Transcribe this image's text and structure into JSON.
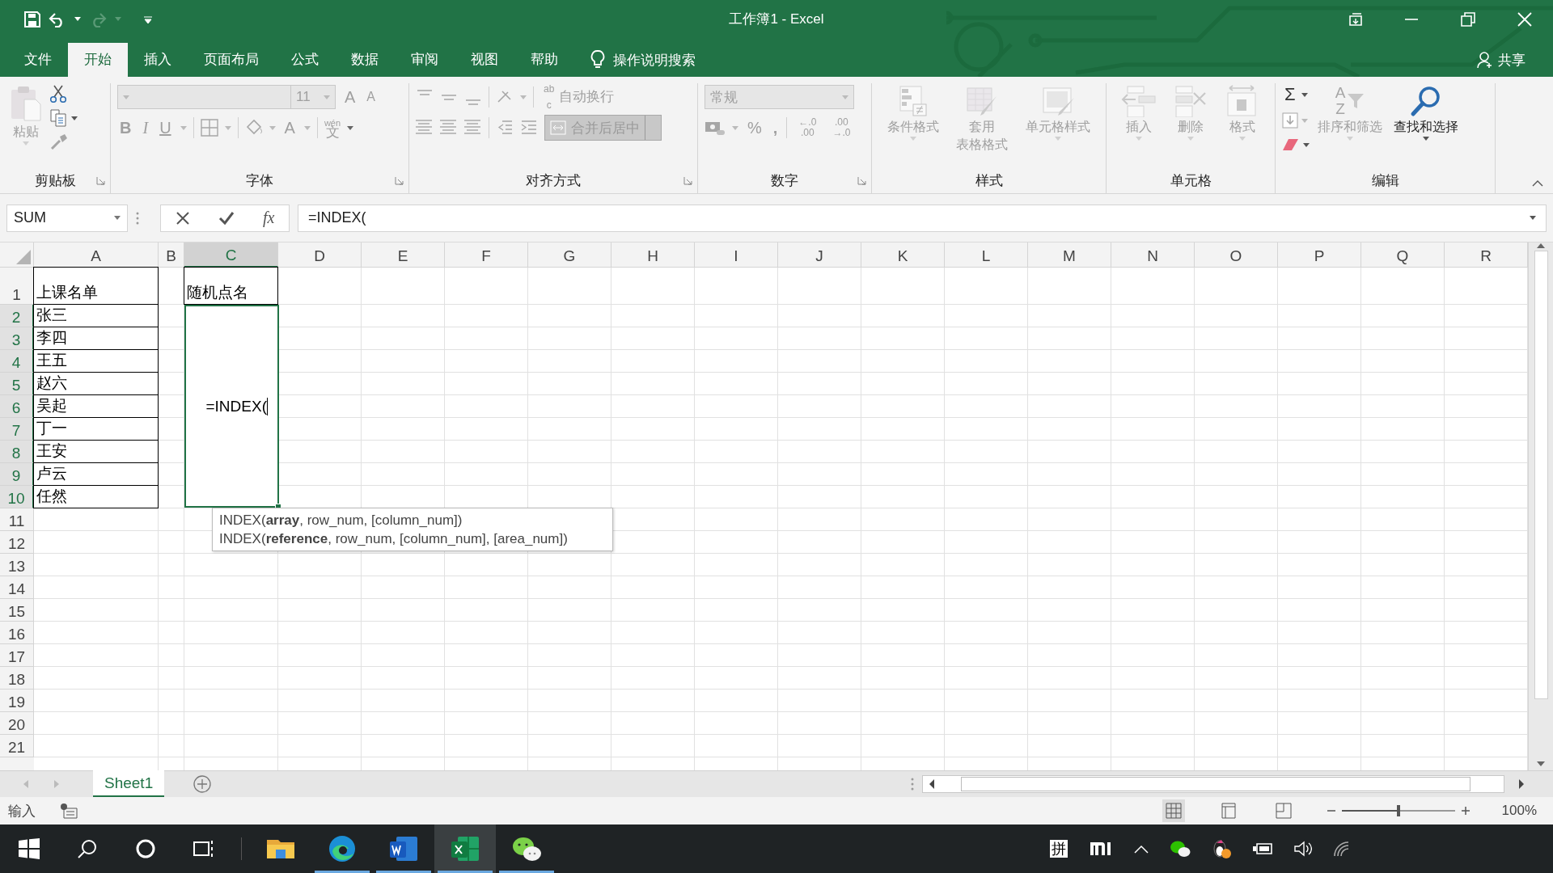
{
  "title_bar": {
    "title": "工作簿1 - Excel",
    "redo_disabled": true
  },
  "tabs": [
    {
      "label": "文件",
      "selected": false
    },
    {
      "label": "开始",
      "selected": true
    },
    {
      "label": "插入",
      "selected": false
    },
    {
      "label": "页面布局",
      "selected": false
    },
    {
      "label": "公式",
      "selected": false
    },
    {
      "label": "数据",
      "selected": false
    },
    {
      "label": "审阅",
      "selected": false
    },
    {
      "label": "视图",
      "selected": false
    },
    {
      "label": "帮助",
      "selected": false
    }
  ],
  "tell_me": {
    "label": "操作说明搜索"
  },
  "share": {
    "label": "共享"
  },
  "ribbon": [
    {
      "kind": "clipboard",
      "label": "剪贴板",
      "paste": {
        "label": "粘贴",
        "disabled": true
      }
    },
    {
      "kind": "font",
      "label": "字体",
      "font_size": "11",
      "grow": "A",
      "shrink": "A",
      "styles": [
        "B",
        "I",
        "U"
      ],
      "font_color": "A",
      "phonetic": [
        "wén",
        "文"
      ]
    },
    {
      "kind": "alignment",
      "label": "对齐方式",
      "wrap": {
        "icon_text": [
          "ab",
          "c"
        ],
        "label": "自动换行",
        "disabled": true
      },
      "merge": {
        "label": "合并后居中",
        "disabled": true
      }
    },
    {
      "kind": "number",
      "label": "数字",
      "format": "常规",
      "percent": "%",
      "comma": ",",
      "decimals": [
        {
          "top": "←.0",
          "bottom": ".00"
        },
        {
          "top": ".00",
          "bottom": "→.0"
        }
      ]
    },
    {
      "kind": "styles",
      "label": "样式",
      "commands": [
        {
          "label": "条件格式",
          "disabled": true
        },
        {
          "label": "套用",
          "label_2": "表格格式",
          "disabled": true
        },
        {
          "label": "单元格样式",
          "disabled": true
        }
      ]
    },
    {
      "kind": "cells",
      "label": "单元格",
      "commands": [
        {
          "label": "插入",
          "disabled": true
        },
        {
          "label": "删除",
          "disabled": true
        },
        {
          "label": "格式",
          "disabled": true
        }
      ]
    },
    {
      "kind": "editing",
      "label": "编辑",
      "sum": "Σ",
      "sort": {
        "label": "排序和筛选",
        "letters": [
          "A",
          "Z"
        ],
        "disabled": true
      },
      "find": {
        "label": "查找和选择",
        "disabled": false
      }
    }
  ],
  "formula_bar": {
    "name_box": "SUM",
    "fx": "fx",
    "formula": "=INDEX("
  },
  "columns": [
    {
      "label": "A",
      "selected": false
    },
    {
      "label": "B",
      "selected": false
    },
    {
      "label": "C",
      "selected": true
    },
    {
      "label": "D",
      "selected": false
    },
    {
      "label": "E",
      "selected": false
    },
    {
      "label": "F",
      "selected": false
    },
    {
      "label": "G",
      "selected": false
    },
    {
      "label": "H",
      "selected": false
    },
    {
      "label": "I",
      "selected": false
    },
    {
      "label": "J",
      "selected": false
    },
    {
      "label": "K",
      "selected": false
    },
    {
      "label": "L",
      "selected": false
    },
    {
      "label": "M",
      "selected": false
    },
    {
      "label": "N",
      "selected": false
    },
    {
      "label": "O",
      "selected": false
    },
    {
      "label": "P",
      "selected": false
    },
    {
      "label": "Q",
      "selected": false
    },
    {
      "label": "R",
      "selected": false
    }
  ],
  "rows": [
    {
      "header": "1",
      "selected": false,
      "a": {
        "text": "上课名单",
        "bordered": true
      },
      "c": {
        "text": "随机点名",
        "bordered": true
      }
    },
    {
      "header": "2",
      "selected": true,
      "a": {
        "text": "张三",
        "bordered": true
      }
    },
    {
      "header": "3",
      "selected": true,
      "a": {
        "text": "李四",
        "bordered": true
      }
    },
    {
      "header": "4",
      "selected": true,
      "a": {
        "text": "王五",
        "bordered": true
      }
    },
    {
      "header": "5",
      "selected": true,
      "a": {
        "text": "赵六",
        "bordered": true
      }
    },
    {
      "header": "6",
      "selected": true,
      "a": {
        "text": "吴起",
        "bordered": true
      }
    },
    {
      "header": "7",
      "selected": true,
      "a": {
        "text": "丁一",
        "bordered": true
      }
    },
    {
      "header": "8",
      "selected": true,
      "a": {
        "text": "王安",
        "bordered": true
      }
    },
    {
      "header": "9",
      "selected": true,
      "a": {
        "text": "卢云",
        "bordered": true
      }
    },
    {
      "header": "10",
      "selected": true,
      "a": {
        "text": "任然",
        "bordered": true
      }
    },
    {
      "header": "11",
      "selected": false
    },
    {
      "header": "12",
      "selected": false
    },
    {
      "header": "13",
      "selected": false
    },
    {
      "header": "14",
      "selected": false
    },
    {
      "header": "15",
      "selected": false
    },
    {
      "header": "16",
      "selected": false
    },
    {
      "header": "17",
      "selected": false
    },
    {
      "header": "18",
      "selected": false
    },
    {
      "header": "19",
      "selected": false
    },
    {
      "header": "20",
      "selected": false
    },
    {
      "header": "21",
      "selected": false
    }
  ],
  "editing_cell": {
    "value": "=INDEX("
  },
  "tooltip": [
    "INDEX(**array**, row_num, [column_num])",
    "INDEX(**reference**, row_num, [column_num], [area_num])"
  ],
  "sheet_tabs": [
    {
      "label": "Sheet1",
      "selected": true
    }
  ],
  "status_bar": {
    "mode": "输入",
    "zoom": "100%",
    "zoom_slider": {
      "level": 0.5
    },
    "views": [
      {
        "kind": "normal",
        "selected": true
      },
      {
        "kind": "page_layout",
        "selected": false
      },
      {
        "kind": "page_break",
        "selected": false
      }
    ]
  },
  "taskbar": {
    "apps": [
      {
        "kind": "explorer",
        "running": false,
        "active": false
      },
      {
        "kind": "edge",
        "running": true,
        "active": false
      },
      {
        "kind": "word",
        "running": true,
        "active": false
      },
      {
        "kind": "excel",
        "running": true,
        "active": true
      },
      {
        "kind": "wechat",
        "running": true,
        "active": false
      }
    ],
    "ime": "拼"
  }
}
